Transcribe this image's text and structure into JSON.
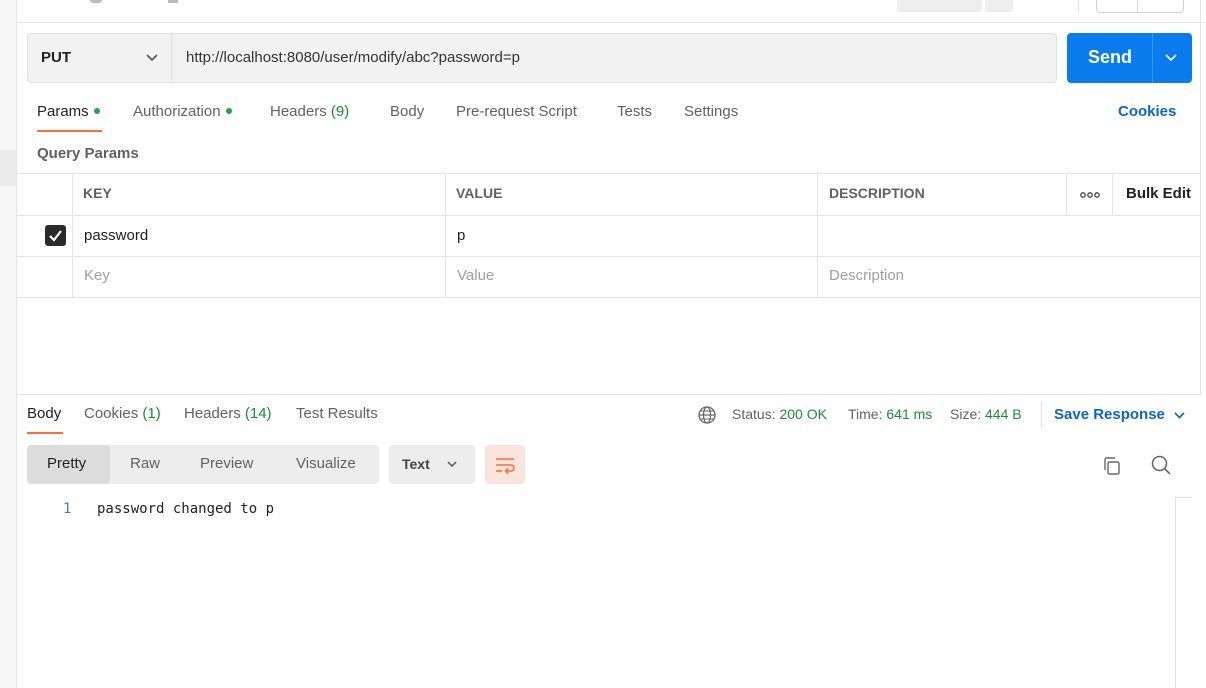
{
  "request": {
    "method": "PUT",
    "url": "http://localhost:8080/user/modify/abc?password=p",
    "send_label": "Send"
  },
  "request_tabs": {
    "params": "Params",
    "authorization": "Authorization",
    "headers": "Headers",
    "headers_count": "(9)",
    "body": "Body",
    "pre_request": "Pre-request Script",
    "tests": "Tests",
    "settings": "Settings",
    "cookies": "Cookies"
  },
  "params": {
    "section_title": "Query Params",
    "columns": [
      "KEY",
      "VALUE",
      "DESCRIPTION"
    ],
    "bulk_edit": "Bulk Edit",
    "rows": [
      {
        "checked": true,
        "key": "password",
        "value": "p",
        "description": ""
      }
    ],
    "placeholder": {
      "key": "Key",
      "value": "Value",
      "description": "Description"
    }
  },
  "response_tabs": {
    "body": "Body",
    "cookies": "Cookies",
    "cookies_count": "(1)",
    "headers": "Headers",
    "headers_count": "(14)",
    "test_results": "Test Results"
  },
  "response_meta": {
    "status_label": "Status:",
    "status_value": "200 OK",
    "time_label": "Time:",
    "time_value": "641 ms",
    "size_label": "Size:",
    "size_value": "444 B",
    "save_response": "Save Response"
  },
  "format": {
    "modes": [
      "Pretty",
      "Raw",
      "Preview",
      "Visualize"
    ],
    "active_mode": "Pretty",
    "language": "Text"
  },
  "response_body": {
    "lines": [
      {
        "number": "1",
        "text": "password changed to p"
      }
    ]
  },
  "colors": {
    "accent_orange": "#ff6c37",
    "send_blue": "#097bed",
    "link_blue": "#0b66c6",
    "success_green": "#1a8a3a"
  }
}
